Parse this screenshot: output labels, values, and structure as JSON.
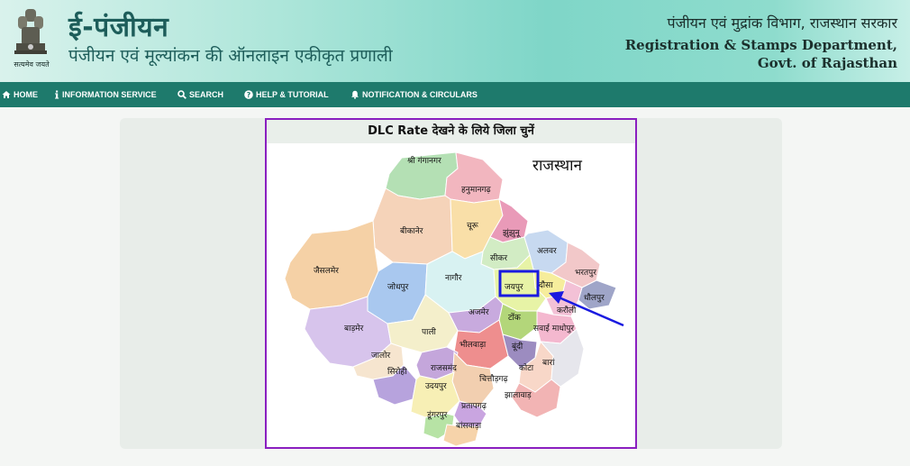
{
  "header": {
    "emblem_caption": "सत्यमेव जयते",
    "title": "ई-पंजीयन",
    "subtitle": "पंजीयन एवं मूल्यांकन की ऑनलाइन एकीकृत प्रणाली",
    "dept_hindi": "पंजीयन एवं मुद्रांक विभाग, राजस्थान सरकार",
    "dept_english_line1": "Registration & Stamps Department,",
    "dept_english_line2": "Govt. of Rajasthan"
  },
  "nav": {
    "items": [
      {
        "label": "HOME",
        "icon": "home-icon"
      },
      {
        "label": "INFORMATION SERVICE",
        "icon": "info-icon"
      },
      {
        "label": "SEARCH",
        "icon": "search-icon"
      },
      {
        "label": "HELP & TUTORIAL",
        "icon": "help-icon"
      },
      {
        "label": "NOTIFICATION & CIRCULARS",
        "icon": "bell-icon"
      }
    ]
  },
  "panel": {
    "title": "DLC Rate देखने के लिये जिला चुनें"
  },
  "map": {
    "state_name": "राजस्थान",
    "selected_district": "जयपुर",
    "districts": {
      "ganganagar": "श्री गंगानगर",
      "hanumangarh": "हनुमानगढ़",
      "bikaner": "बीकानेर",
      "churu": "चूरू",
      "jhunjhunu": "झुंझुनू",
      "sikar": "सीकर",
      "alwar": "अलवर",
      "bharatpur": "भरतपुर",
      "jaisalmer": "जैसलमेर",
      "jodhpur": "जोधपुर",
      "nagaur": "नागौर",
      "jaipur": "जयपुर",
      "dausa": "दौसा",
      "dholpur": "धौलपुर",
      "karauli": "करौली",
      "ajmer": "अजमेर",
      "tonk": "टोंक",
      "sawai_madhopur": "सवाई माधोपुर",
      "barmer": "बाड़मेर",
      "pali": "पाली",
      "bhilwara": "भीलवाड़ा",
      "bundi": "बूंदी",
      "jalore": "जालोर",
      "sirohi": "सिरोही",
      "rajsamand": "राजसमंद",
      "chittorgarh": "चित्तौड़गढ़",
      "kota": "कोटा",
      "baran": "बारां",
      "udaipur": "उदयपुर",
      "jhalawar": "झालावाड़",
      "pratapgarh": "प्रतापगढ़",
      "dungarpur": "डूंगरपुर",
      "banswara": "बांसवाड़ा"
    }
  },
  "colors": {
    "nav_bg": "#1e7a6c",
    "panel_border": "#8a1fc0",
    "selection_box": "#1a1ae0",
    "arrow": "#1a1ae0",
    "title_text": "#1d5d5a"
  }
}
